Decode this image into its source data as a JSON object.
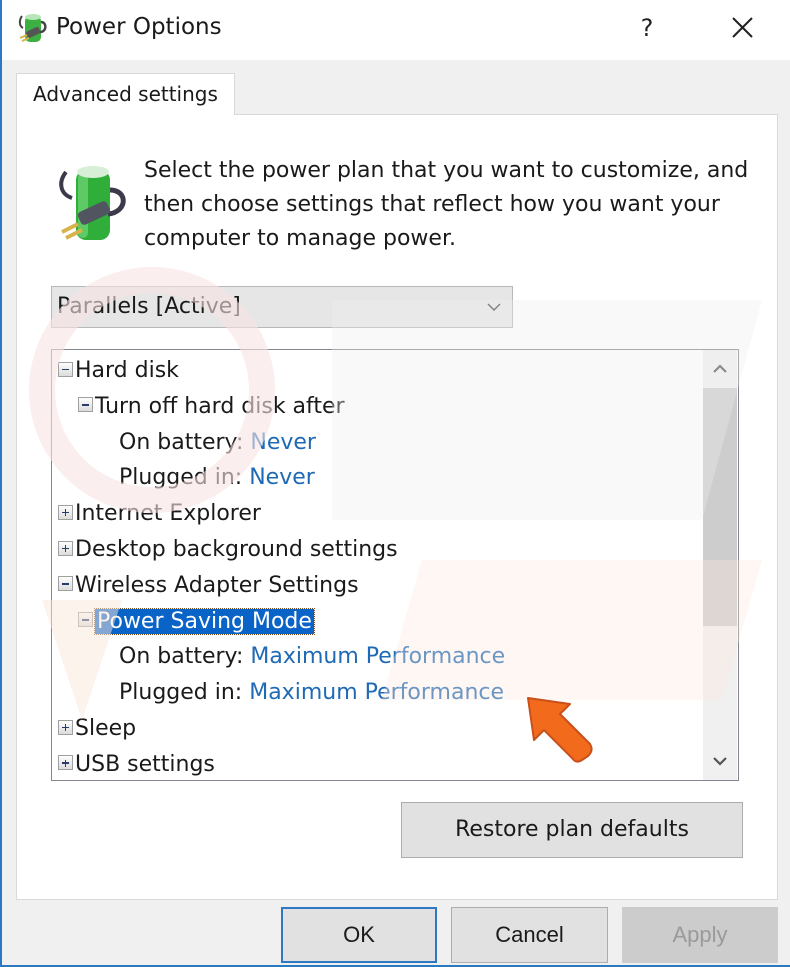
{
  "window": {
    "title": "Power Options",
    "help_label": "?",
    "close_icon": "close-icon"
  },
  "tabs": [
    {
      "label": "Advanced settings",
      "active": true
    }
  ],
  "intro_text": "Select the power plan that you want to customize, and then choose settings that reflect how you want your computer to manage power.",
  "plan_select": {
    "selected": "Parallels [Active]",
    "icon": "chevron-down-icon"
  },
  "tree": {
    "rows": [
      {
        "label": "Hard disk",
        "expander": "minus",
        "level": 0
      },
      {
        "label": "Turn off hard disk after",
        "expander": "minus",
        "level": 1
      },
      {
        "label": "On battery:",
        "value": "Never",
        "level": 2
      },
      {
        "label": "Plugged in:",
        "value": "Never",
        "level": 2
      },
      {
        "label": "Internet Explorer",
        "expander": "plus",
        "level": 0
      },
      {
        "label": "Desktop background settings",
        "expander": "plus",
        "level": 0
      },
      {
        "label": "Wireless Adapter Settings",
        "expander": "minus",
        "level": 0
      },
      {
        "label": "Power Saving Mode",
        "expander": "minus",
        "level": 1,
        "selected": true
      },
      {
        "label": "On battery:",
        "value": "Maximum Performance",
        "level": 2
      },
      {
        "label": "Plugged in:",
        "value": "Maximum Performance",
        "level": 2
      },
      {
        "label": "Sleep",
        "expander": "plus",
        "level": 0
      },
      {
        "label": "USB settings",
        "expander": "plus",
        "level": 0
      }
    ]
  },
  "buttons": {
    "restore": "Restore plan defaults",
    "ok": "OK",
    "cancel": "Cancel",
    "apply": "Apply",
    "apply_enabled": false
  },
  "colors": {
    "accent": "#2b79c2",
    "selection": "#0a64c8",
    "value_link": "#1f6ab5",
    "annotation_arrow": "#f26b1d"
  }
}
